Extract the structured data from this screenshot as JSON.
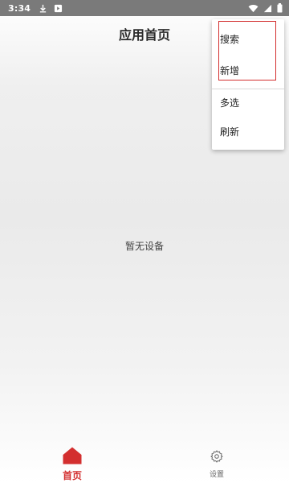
{
  "status_bar": {
    "time": "3:34",
    "icons": [
      "download-icon",
      "notification-icon",
      "wifi-icon",
      "signal-icon",
      "battery-icon"
    ]
  },
  "header": {
    "title": "应用首页"
  },
  "main": {
    "empty_text": "暂无设备"
  },
  "menu": {
    "items": [
      {
        "label": "搜索"
      },
      {
        "label": "新增"
      },
      {
        "label": "多选"
      },
      {
        "label": "刷新"
      }
    ],
    "highlight_color": "#d32f2f"
  },
  "bottom_nav": {
    "items": [
      {
        "label": "首页",
        "icon": "home-icon",
        "active": true
      },
      {
        "label": "设置",
        "icon": "gear-icon",
        "active": false
      }
    ],
    "active_color": "#d32f2f",
    "inactive_color": "#666666"
  }
}
